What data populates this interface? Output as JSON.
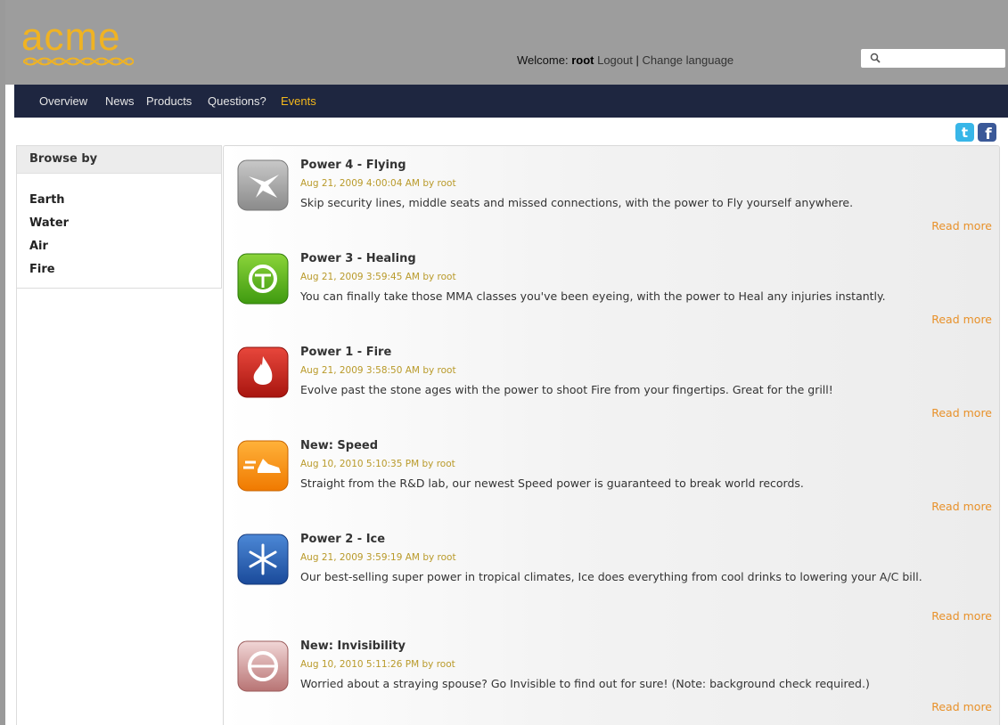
{
  "header": {
    "logo_text": "acme",
    "welcome_label": "Welcome:",
    "username": "root",
    "logout_label": "Logout",
    "separator": "|",
    "change_language_label": "Change language",
    "search_placeholder": ""
  },
  "nav": {
    "items": [
      {
        "label": "Overview"
      },
      {
        "label": "News"
      },
      {
        "label": "Products"
      },
      {
        "label": "Questions?"
      },
      {
        "label": "Events",
        "active": true
      }
    ]
  },
  "social": {
    "twitter": "twitter-icon",
    "facebook": "facebook-icon"
  },
  "sidebar": {
    "heading": "Browse by",
    "items": [
      {
        "label": "Earth"
      },
      {
        "label": "Water"
      },
      {
        "label": "Air"
      },
      {
        "label": "Fire"
      }
    ]
  },
  "events": [
    {
      "icon": "bird-icon",
      "title": "Power 4 - Flying",
      "meta": "Aug 21, 2009 4:00:04 AM by root",
      "description": "Skip security lines, middle seats and missed connections, with the power to Fly yourself anywhere.",
      "read_more": "Read more"
    },
    {
      "icon": "healing-icon",
      "title": "Power 3 - Healing",
      "meta": "Aug 21, 2009 3:59:45 AM by root",
      "description": "You can finally take those MMA classes you've been eyeing, with the power to Heal any injuries instantly.",
      "read_more": "Read more"
    },
    {
      "icon": "flame-icon",
      "title": "Power 1 - Fire",
      "meta": "Aug 21, 2009 3:58:50 AM by root",
      "description": "Evolve past the stone ages with the power to shoot Fire from your fingertips. Great for the grill!",
      "read_more": "Read more"
    },
    {
      "icon": "speed-shoe-icon",
      "title": "New: Speed",
      "meta": "Aug 10, 2010 5:10:35 PM by root",
      "description": "Straight from the R&D lab, our newest Speed power is guaranteed to break world records.",
      "read_more": "Read more"
    },
    {
      "icon": "snowflake-icon",
      "title": "Power 2 - Ice",
      "meta": "Aug 21, 2009 3:59:19 AM by root",
      "description": "Our best-selling super power in tropical climates, Ice does everything from cool drinks to lowering your A/C bill.",
      "read_more": "Read more"
    },
    {
      "icon": "invisibility-icon",
      "title": "New: Invisibility",
      "meta": "Aug 10, 2010 5:11:26 PM by root",
      "description": "Worried about a straying spouse? Go Invisible to find out for sure! (Note: background check required.)",
      "read_more": "Read more"
    }
  ],
  "colors": {
    "accent": "#f4b81c",
    "nav_bg": "#1e2640",
    "header_bg": "#9d9d9d",
    "read_more": "#e8912a",
    "meta": "#b99a2a"
  }
}
